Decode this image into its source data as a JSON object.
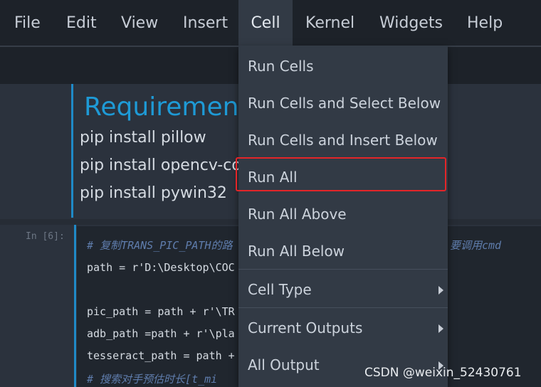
{
  "menubar": {
    "items": [
      "File",
      "Edit",
      "View",
      "Insert",
      "Cell",
      "Kernel",
      "Widgets",
      "Help"
    ],
    "active": "Cell"
  },
  "markdown_cell": {
    "heading": "Requirement",
    "lines": [
      "pip install pillow",
      "pip install opencv-cor",
      "pip install pywin32"
    ]
  },
  "code_cell": {
    "prompt": "In  [6]:",
    "lines": [
      {
        "text": "# 复制TRANS_PIC_PATH的路",
        "kind": "comment"
      },
      {
        "text": "path =  r'D:\\Desktop\\COC",
        "kind": "code"
      },
      {
        "text": "",
        "kind": "code"
      },
      {
        "text": "pic_path = path + r'\\TR",
        "kind": "code"
      },
      {
        "text": "adb_path =path + r'\\pla",
        "kind": "code"
      },
      {
        "text": "tesseract_path = path +",
        "kind": "code"
      },
      {
        "text": "# 搜索对手预估时长[t_mi",
        "kind": "comment"
      }
    ],
    "comment_tail": "要调用cmd"
  },
  "cell_menu": {
    "items": [
      {
        "label": "Run Cells",
        "submenu": false
      },
      {
        "label": "Run Cells and Select Below",
        "submenu": false
      },
      {
        "label": "Run Cells and Insert Below",
        "submenu": false
      },
      {
        "label": "Run All",
        "submenu": false,
        "highlighted": true
      },
      {
        "label": "Run All Above",
        "submenu": false
      },
      {
        "label": "Run All Below",
        "submenu": false
      },
      {
        "label": "Cell Type",
        "submenu": true
      },
      {
        "label": "Current Outputs",
        "submenu": true
      },
      {
        "label": "All Output",
        "submenu": true
      }
    ]
  },
  "watermark": "CSDN @weixin_52430761",
  "colors": {
    "accent": "#1e9ad6",
    "highlight_border": "#e42528",
    "menu_bg": "#323a45",
    "menubar_bg": "#1d2229",
    "comment": "#5f7dad"
  }
}
